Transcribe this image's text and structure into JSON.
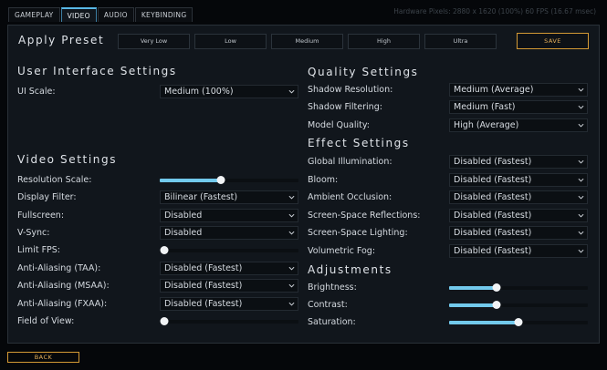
{
  "tabs": [
    "GAMEPLAY",
    "VIDEO",
    "AUDIO",
    "KEYBINDING"
  ],
  "active_tab": "VIDEO",
  "hardware_info": "Hardware Pixels: 2880 x 1620 (100%) 60 FPS (16.67 msec)",
  "preset": {
    "label": "Apply Preset",
    "options": [
      "Very Low",
      "Low",
      "Medium",
      "High",
      "Ultra"
    ],
    "save_label": "SAVE"
  },
  "ui_settings": {
    "title": "User Interface Settings",
    "ui_scale_label": "UI Scale:",
    "ui_scale_value": "Medium (100%)"
  },
  "video_settings": {
    "title": "Video Settings",
    "resolution_scale_label": "Resolution Scale:",
    "resolution_scale_level": 0.44,
    "display_filter_label": "Display Filter:",
    "display_filter_value": "Bilinear (Fastest)",
    "fullscreen_label": "Fullscreen:",
    "fullscreen_value": "Disabled",
    "vsync_label": "V-Sync:",
    "vsync_value": "Disabled",
    "limit_fps_label": "Limit FPS:",
    "limit_fps_level": 0.0,
    "aa_taa_label": "Anti-Aliasing (TAA):",
    "aa_taa_value": "Disabled (Fastest)",
    "aa_msaa_label": "Anti-Aliasing (MSAA):",
    "aa_msaa_value": "Disabled (Fastest)",
    "aa_fxaa_label": "Anti-Aliasing (FXAA):",
    "aa_fxaa_value": "Disabled (Fastest)",
    "fov_label": "Field of View:",
    "fov_level": 0.0
  },
  "quality_settings": {
    "title": "Quality Settings",
    "shadow_resolution_label": "Shadow Resolution:",
    "shadow_resolution_value": "Medium (Average)",
    "shadow_filtering_label": "Shadow Filtering:",
    "shadow_filtering_value": "Medium (Fast)",
    "model_quality_label": "Model Quality:",
    "model_quality_value": "High (Average)"
  },
  "effect_settings": {
    "title": "Effect Settings",
    "gi_label": "Global Illumination:",
    "gi_value": "Disabled (Fastest)",
    "bloom_label": "Bloom:",
    "bloom_value": "Disabled (Fastest)",
    "ao_label": "Ambient Occlusion:",
    "ao_value": "Disabled (Fastest)",
    "ssr_label": "Screen-Space Reflections:",
    "ssr_value": "Disabled (Fastest)",
    "ssl_label": "Screen-Space Lighting:",
    "ssl_value": "Disabled (Fastest)",
    "fog_label": "Volumetric Fog:",
    "fog_value": "Disabled (Fastest)"
  },
  "adjustments": {
    "title": "Adjustments",
    "brightness_label": "Brightness:",
    "brightness_level": 0.34,
    "contrast_label": "Contrast:",
    "contrast_level": 0.34,
    "saturation_label": "Saturation:",
    "saturation_level": 0.5
  },
  "back_label": "BACK",
  "colors": {
    "accent": "#72c9ec",
    "gold": "#d49a35",
    "panel": "#11161c"
  },
  "icons": {
    "dropdown": "chevron-down-icon"
  }
}
